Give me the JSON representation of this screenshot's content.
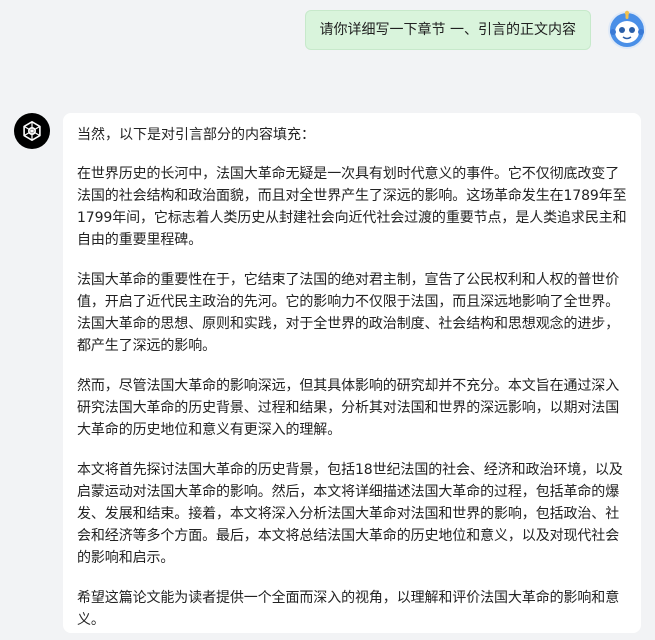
{
  "user": {
    "message": "请你详细写一下章节 一、引言的正文内容"
  },
  "assistant": {
    "intro": "当然，以下是对引言部分的内容填充：",
    "paragraphs": [
      "在世界历史的长河中，法国大革命无疑是一次具有划时代意义的事件。它不仅彻底改变了法国的社会结构和政治面貌，而且对全世界产生了深远的影响。这场革命发生在1789年至1799年间，它标志着人类历史从封建社会向近代社会过渡的重要节点，是人类追求民主和自由的重要里程碑。",
      "法国大革命的重要性在于，它结束了法国的绝对君主制，宣告了公民权利和人权的普世价值，开启了近代民主政治的先河。它的影响力不仅限于法国，而且深远地影响了全世界。法国大革命的思想、原则和实践，对于全世界的政治制度、社会结构和思想观念的进步，都产生了深远的影响。",
      "然而，尽管法国大革命的影响深远，但其具体影响的研究却并不充分。本文旨在通过深入研究法国大革命的历史背景、过程和结果，分析其对法国和世界的深远影响，以期对法国大革命的历史地位和意义有更深入的理解。",
      "本文将首先探讨法国大革命的历史背景，包括18世纪法国的社会、经济和政治环境，以及启蒙运动对法国大革命的影响。然后，本文将详细描述法国大革命的过程，包括革命的爆发、发展和结束。接着，本文将深入分析法国大革命对法国和世界的影响，包括政治、社会和经济等多个方面。最后，本文将总结法国大革命的历史地位和意义，以及对现代社会的影响和启示。",
      "希望这篇论文能为读者提供一个全面而深入的视角，以理解和评价法国大革命的影响和意义。"
    ]
  },
  "icons": {
    "user_avatar": "robot-avatar-icon",
    "bot_avatar": "openai-logo-icon"
  },
  "colors": {
    "user_bubble": "#d9f4dc",
    "background": "#f2f3f5",
    "card": "#ffffff"
  }
}
